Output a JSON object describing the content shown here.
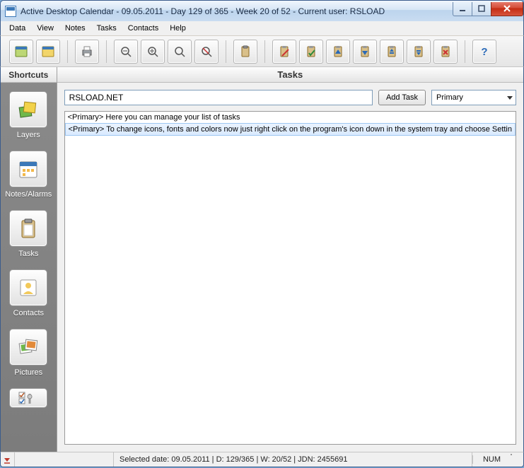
{
  "title": "Active Desktop Calendar - 09.05.2011 - Day 129 of 365 - Week 20 of 52 - Current user: RSLOAD",
  "menu": {
    "data": "Data",
    "view": "View",
    "notes": "Notes",
    "tasks": "Tasks",
    "contacts": "Contacts",
    "help": "Help"
  },
  "sidebar": {
    "header": "Shortcuts",
    "items": {
      "layers": "Layers",
      "notes": "Notes/Alarms",
      "tasks": "Tasks",
      "contacts": "Contacts",
      "pictures": "Pictures"
    }
  },
  "content": {
    "header": "Tasks",
    "input_value": "RSLOAD.NET",
    "add_btn": "Add Task",
    "combo_value": "Primary",
    "rows": {
      "r0": "<Primary> Here you can manage your list of tasks",
      "r1": "<Primary> To change icons, fonts and colors now just right click on the program's icon down in the system tray and choose Settin"
    }
  },
  "status": {
    "main": "Selected date: 09.05.2011 | D: 129/365 | W: 20/52 | JDN: 2455691",
    "num": "NUM"
  }
}
